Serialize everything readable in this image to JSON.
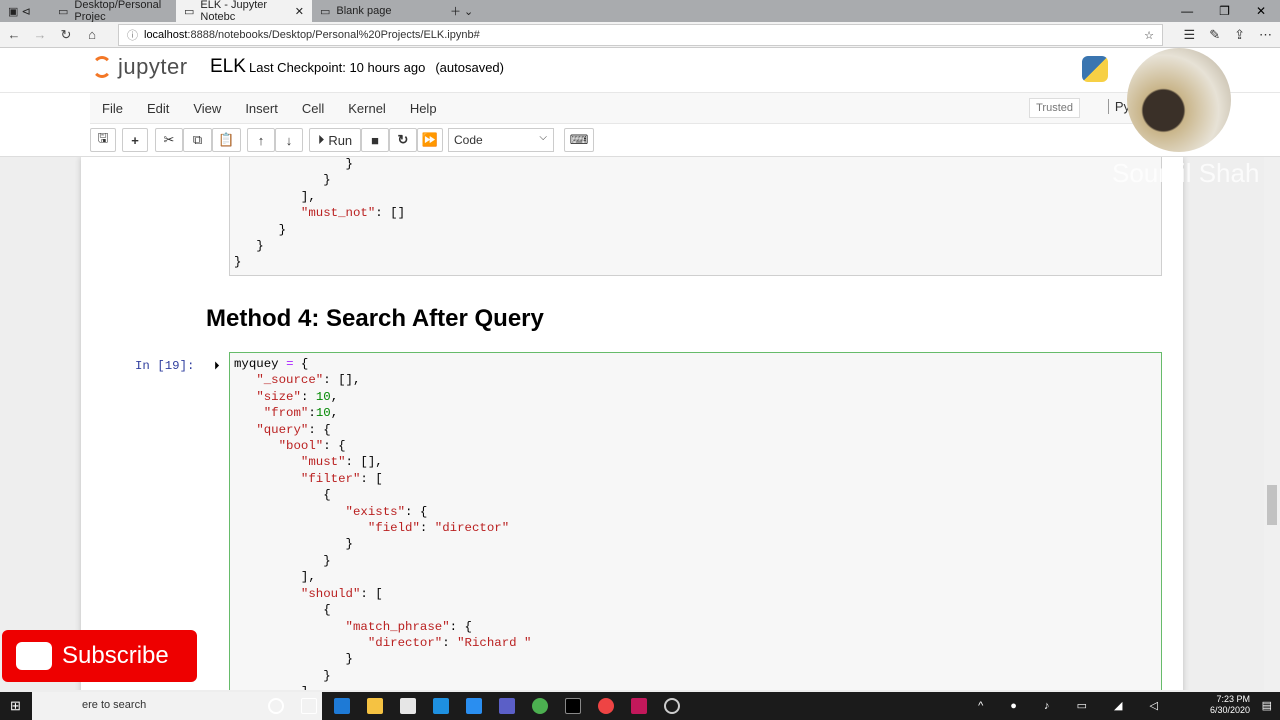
{
  "browser": {
    "tabs": [
      {
        "title": "Desktop/Personal Projec",
        "active": false
      },
      {
        "title": "ELK - Jupyter Notebc",
        "active": true
      },
      {
        "title": "Blank page",
        "active": false
      }
    ],
    "url_host": "localhost",
    "url_rest": ":8888/notebooks/Desktop/Personal%20Projects/ELK.ipynb#"
  },
  "header": {
    "logo_text": "jupyter",
    "notebook_name": "ELK",
    "checkpoint": "Last Checkpoint: 10 hours ago",
    "autosave": "(autosaved)"
  },
  "menu": [
    "File",
    "Edit",
    "View",
    "Insert",
    "Cell",
    "Kernel",
    "Help"
  ],
  "status": {
    "trusted": "Trusted",
    "kernel": "Py"
  },
  "toolbar": {
    "run_label": "Run",
    "cell_type": "Code"
  },
  "cells": {
    "prev_code": "               }\n            }\n         ],\n         \"must_not\": []\n      }\n   }\n}",
    "heading": "Method 4: Search After Query",
    "prompt": "In [19]:",
    "code": "myquey = {\n   \"_source\": [],\n   \"size\": 10,\n    \"from\":10,\n   \"query\": {\n      \"bool\": {\n         \"must\": [],\n         \"filter\": [\n            {\n               \"exists\": {\n                  \"field\": \"director\"\n               }\n            }\n         ],\n         \"should\": [\n            {\n               \"match_phrase\": {\n                  \"director\": \"Richard \"\n               }\n            }\n         ],"
  },
  "overlay": {
    "watermark": "Soumil Shah",
    "subscribe": "Subscribe",
    "subscribe_color": "#e00000"
  },
  "taskbar": {
    "search": "ere to search",
    "time": "7:23 PM",
    "date": "6/30/2020"
  }
}
